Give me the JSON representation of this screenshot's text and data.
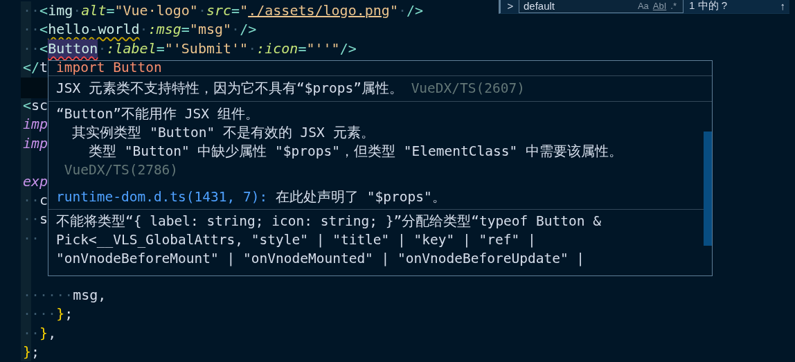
{
  "editor": {
    "lines": [
      {
        "kind": "code",
        "current": false,
        "tokens": [
          {
            "kind": "ws",
            "text": "··"
          },
          {
            "kind": "punct",
            "text": "<"
          },
          {
            "kind": "tag",
            "text": "img"
          },
          {
            "kind": "ws",
            "text": "·"
          },
          {
            "kind": "attr",
            "text": "alt"
          },
          {
            "kind": "punct",
            "text": "="
          },
          {
            "kind": "string",
            "text": "\"Vue·logo\""
          },
          {
            "kind": "ws",
            "text": "·"
          },
          {
            "kind": "attr",
            "text": "src"
          },
          {
            "kind": "punct",
            "text": "="
          },
          {
            "kind": "string",
            "text": "\""
          },
          {
            "kind": "string",
            "text": "./assets/logo.png",
            "link": true
          },
          {
            "kind": "string",
            "text": "\""
          },
          {
            "kind": "ws",
            "text": "·"
          },
          {
            "kind": "punct",
            "text": "/>"
          }
        ]
      },
      {
        "kind": "code",
        "current": false,
        "tokens": [
          {
            "kind": "ws",
            "text": "··"
          },
          {
            "kind": "punct",
            "text": "<"
          },
          {
            "kind": "tag",
            "text": "hello-world",
            "warning": true
          },
          {
            "kind": "ws",
            "text": "·"
          },
          {
            "kind": "attr",
            "text": ":msg"
          },
          {
            "kind": "punct",
            "text": "="
          },
          {
            "kind": "string",
            "text": "\"msg\""
          },
          {
            "kind": "ws",
            "text": "·"
          },
          {
            "kind": "punct",
            "text": "/>"
          }
        ]
      },
      {
        "kind": "code",
        "current": false,
        "tokens": [
          {
            "kind": "ws",
            "text": "··"
          },
          {
            "kind": "punct",
            "text": "<"
          },
          {
            "kind": "tag",
            "text": "Button",
            "error": true,
            "highlight": true
          },
          {
            "kind": "ws",
            "text": "·"
          },
          {
            "kind": "attr",
            "text": ":label"
          },
          {
            "kind": "punct",
            "text": "="
          },
          {
            "kind": "string",
            "text": "\"'Submit'\""
          },
          {
            "kind": "ws",
            "text": "·"
          },
          {
            "kind": "attr",
            "text": ":icon"
          },
          {
            "kind": "punct",
            "text": "="
          },
          {
            "kind": "string",
            "text": "\"''\""
          },
          {
            "kind": "punct",
            "text": "/>"
          }
        ]
      },
      {
        "kind": "code",
        "current": false,
        "tokens": [
          {
            "kind": "punct",
            "text": "</"
          },
          {
            "kind": "text",
            "text": "t"
          }
        ]
      },
      {
        "kind": "blank",
        "current": true
      },
      {
        "kind": "code",
        "current": false,
        "tokens": [
          {
            "kind": "punct",
            "text": "<"
          },
          {
            "kind": "text",
            "text": "sc"
          }
        ]
      },
      {
        "kind": "code",
        "current": false,
        "tokens": [
          {
            "kind": "keyword",
            "text": "imp"
          }
        ]
      },
      {
        "kind": "code",
        "current": false,
        "tokens": [
          {
            "kind": "keyword",
            "text": "imp"
          }
        ]
      },
      {
        "kind": "blank",
        "current": false
      },
      {
        "kind": "code",
        "current": false,
        "tokens": [
          {
            "kind": "keyword",
            "text": "exp"
          }
        ]
      },
      {
        "kind": "code",
        "current": false,
        "tokens": [
          {
            "kind": "ws",
            "text": "··"
          },
          {
            "kind": "text",
            "text": "c"
          }
        ]
      },
      {
        "kind": "code",
        "current": false,
        "tokens": [
          {
            "kind": "ws",
            "text": "··"
          },
          {
            "kind": "text",
            "text": "s"
          }
        ]
      },
      {
        "kind": "code",
        "current": false,
        "tokens": [
          {
            "kind": "ws",
            "text": "··"
          }
        ]
      },
      {
        "kind": "blank",
        "current": false
      },
      {
        "kind": "blank",
        "current": false
      },
      {
        "kind": "code",
        "current": false,
        "tokens": [
          {
            "kind": "ws",
            "text": "······"
          },
          {
            "kind": "text",
            "text": "msg,"
          }
        ]
      },
      {
        "kind": "code",
        "current": false,
        "tokens": [
          {
            "kind": "ws",
            "text": "····"
          },
          {
            "kind": "brace",
            "text": "}"
          },
          {
            "kind": "text",
            "text": ";"
          }
        ]
      },
      {
        "kind": "code",
        "current": false,
        "tokens": [
          {
            "kind": "ws",
            "text": "··"
          },
          {
            "kind": "brace",
            "text": "}"
          },
          {
            "kind": "text",
            "text": ","
          }
        ]
      },
      {
        "kind": "code",
        "current": false,
        "tokens": [
          {
            "kind": "brace",
            "text": "}"
          },
          {
            "kind": "text",
            "text": ";"
          }
        ]
      }
    ]
  },
  "hover": {
    "sections": [
      {
        "parts": [
          {
            "kind": "title",
            "text": "import Button"
          }
        ]
      },
      {
        "parts": [
          {
            "kind": "message",
            "text": "JSX 元素类不支持特性，因为它不具有“$props”属性。 "
          },
          {
            "kind": "source",
            "text": "VueDX/TS(2607)"
          }
        ]
      },
      {
        "parts": [
          {
            "kind": "message",
            "text": "“Button”不能用作 JSX 组件。"
          },
          {
            "kind": "message",
            "text": "  其实例类型 \"Button\" 不是有效的 JSX 元素。"
          },
          {
            "kind": "message",
            "text": "    类型 \"Button\" 中缺少属性 \"$props\"，但类型 \"ElementClass\" 中需要该属性。"
          },
          {
            "kind": "source",
            "text": " VueDX/TS(2786)"
          },
          {
            "kind": "related",
            "link": "runtime-dom.d.ts(1431, 7):",
            "text": "在此处声明了 \"$props\"。"
          }
        ]
      },
      {
        "parts": [
          {
            "kind": "message",
            "text": "不能将类型“{ label: string; icon: string; }”分配给类型“typeof Button &"
          },
          {
            "kind": "message",
            "text": "Pick<__VLS_GlobalAttrs, \"style\" | \"title\" | \"key\" | \"ref\" |"
          },
          {
            "kind": "message",
            "text": "\"onVnodeBeforeMount\" | \"onVnodeMounted\" | \"onVnodeBeforeUpdate\" |"
          }
        ]
      }
    ]
  },
  "find": {
    "toggle": ">",
    "value": "default",
    "options": [
      {
        "label": "Aa",
        "on": false
      },
      {
        "label": "AbI",
        "on": false
      },
      {
        "label": ".*",
        "on": false
      }
    ],
    "count": "1 中的 ?",
    "prev": "↑"
  }
}
